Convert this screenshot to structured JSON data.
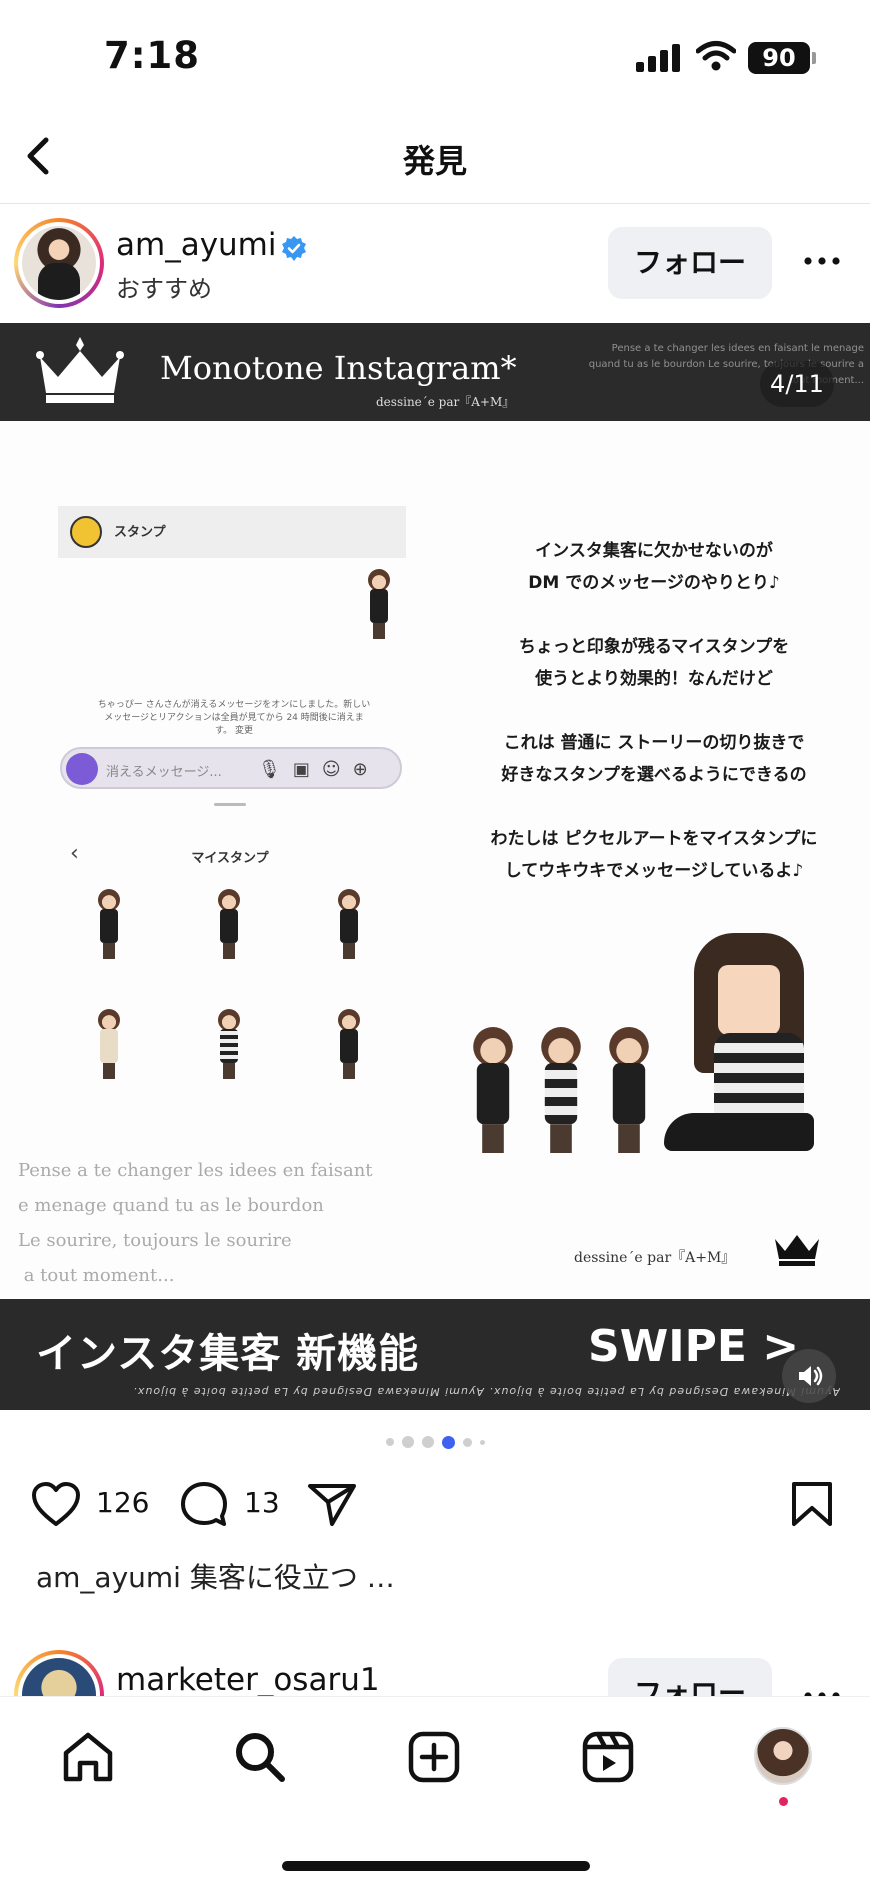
{
  "status_bar": {
    "time": "7:18",
    "battery": "90"
  },
  "nav": {
    "title": "発見"
  },
  "post": {
    "username": "am_ayumi",
    "sub_label": "おすすめ",
    "follow_label": "フォロー",
    "counter": "4/11",
    "image": {
      "banner_title": "Monotone Instagram*",
      "banner_sub": "dessine´e par『A+M』",
      "banner_script": "Pense a te changer les idees en faisant le menage quand tu as le bourdon Le sourire, toujours le sourire a tout moment...",
      "stamp_label": "スタンプ",
      "chat_note": "ちゃっぴー さんさんが消えるメッセージをオンにしました。新しいメッセージとリアクションは全員が見てから 24 時間後に消えます。 変更",
      "message_placeholder": "消えるメッセージ...",
      "mystamp_title": "マイスタンプ",
      "jp_lines": [
        "インスタ集客に欠かせないのが",
        "DM でのメッセージのやりとり♪",
        "ちょっと印象が残るマイスタンプを",
        "使うとより効果的！なんだけど",
        "これは 普通に ストーリーの切り抜きで",
        "好きなスタンプを選べるようにできるの",
        "わたしは ピクセルアートをマイスタンプに",
        "してウキウキでメッセージしているよ♪"
      ],
      "script_lines": [
        "Pense a te changer les idees en faisant",
        "e menage quand tu as le bourdon",
        "Le sourire, toujours le sourire",
        " a tout moment..."
      ],
      "credit": "dessine´e par『A+M』",
      "bottom_left": "インスタ集客 新機能",
      "bottom_right": "SWIPE >",
      "bottom_mirror": "Ayumi Minekawa   Designed by   La petite boite à bijoux.   Ayumi Minekawa   Designed by   La petite boite à bijoux."
    },
    "likes": "126",
    "comments": "13",
    "caption_user": "am_ayumi",
    "caption_text": "集客に役立つ …",
    "carousel": {
      "total": 6,
      "active_index": 3
    }
  },
  "next_post": {
    "username": "marketer_osaru1",
    "follow_label": "フォロー"
  },
  "colors": {
    "accent": "#3e61f0",
    "verified": "#3897f0",
    "banner": "#2b2b2b"
  }
}
